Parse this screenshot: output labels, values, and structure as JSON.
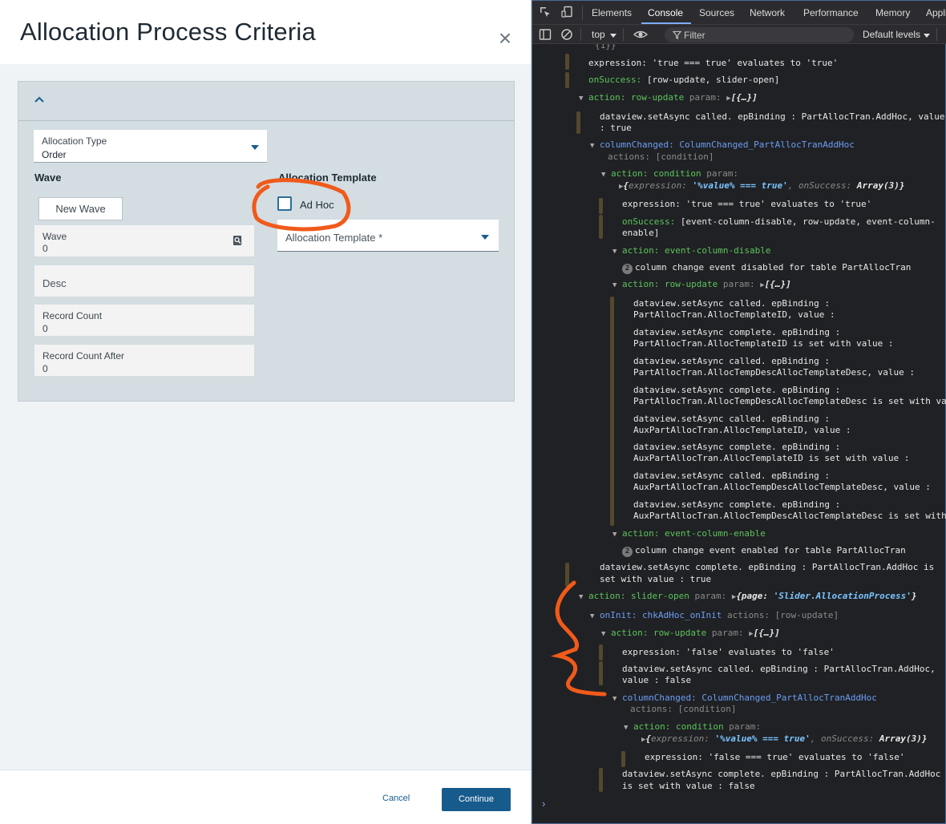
{
  "dialog": {
    "title": "Allocation Process Criteria",
    "close_icon": "×",
    "allocation_type": {
      "label": "Allocation Type",
      "value": "Order"
    },
    "wave_section": "Wave",
    "new_wave_button": "New Wave",
    "wave_field": {
      "label": "Wave",
      "value": "0"
    },
    "desc_field": {
      "placeholder": "Desc"
    },
    "record_count": {
      "label": "Record Count",
      "value": "0"
    },
    "record_count_after": {
      "label": "Record Count After",
      "value": "0"
    },
    "template_section": "Allocation Template",
    "adhoc_label": "Ad Hoc",
    "adhoc_checked": false,
    "template_field": {
      "placeholder": "Allocation Template *"
    },
    "cancel": "Cancel",
    "continue": "Continue"
  },
  "devtools": {
    "tabs": [
      "Elements",
      "Console",
      "Sources",
      "Network",
      "Performance",
      "Memory",
      "Application"
    ],
    "active_tab": "Console",
    "context": "top",
    "filter_placeholder": "Filter",
    "levels": "Default levels",
    "console": {
      "l0": "{1}}",
      "l1": "expression: 'true === true' evaluates to 'true'",
      "l2a": "onSuccess:",
      "l2b": "[row-update, slider-open]",
      "l3a": "action: row-update",
      "l3b": "param:",
      "l3c": "[{…}]",
      "l4a": "dataview.setAsync called. epBinding : PartAllocTran.AddHoc, value",
      "l4b": ": true",
      "l5a": "columnChanged: ColumnChanged_PartAllocTranAddHoc",
      "l5b": "actions: [condition]",
      "l6a": "action: condition",
      "l6b": "param:",
      "l7a": "expression:",
      "l7b": "'%value% === true'",
      "l7c": ", onSuccess:",
      "l7d": "Array(3)}",
      "l8": "expression: 'true === true' evaluates to 'true'",
      "l9a": "onSuccess:",
      "l9b": "[event-column-disable, row-update, event-column-",
      "l9c": "enable]",
      "l10": "action: event-column-disable",
      "l11n": "2",
      "l11": "column change event disabled for table PartAllocTran",
      "l12a": "action: row-update",
      "l12b": "param:",
      "l12c": "[{…}]",
      "l13a": "dataview.setAsync called. epBinding :",
      "l13b": "PartAllocTran.AllocTemplateID, value :",
      "l14a": "dataview.setAsync complete. epBinding :",
      "l14b": "PartAllocTran.AllocTemplateID is set with value :",
      "l15a": "dataview.setAsync called. epBinding :",
      "l15b": "PartAllocTran.AllocTempDescAllocTemplateDesc, value :",
      "l16a": "dataview.setAsync complete. epBinding :",
      "l16b": "PartAllocTran.AllocTempDescAllocTemplateDesc is set with value :",
      "l17a": "dataview.setAsync called. epBinding :",
      "l17b": "AuxPartAllocTran.AllocTemplateID, value :",
      "l18a": "dataview.setAsync complete. epBinding :",
      "l18b": "AuxPartAllocTran.AllocTemplateID is set with value :",
      "l19a": "dataview.setAsync called. epBinding :",
      "l19b": "AuxPartAllocTran.AllocTempDescAllocTemplateDesc, value :",
      "l20a": "dataview.setAsync complete. epBinding :",
      "l20b": "AuxPartAllocTran.AllocTempDescAllocTemplateDesc is set with value :",
      "l21": "action: event-column-enable",
      "l22n": "2",
      "l22": "column change event enabled for table PartAllocTran",
      "l23a": "dataview.setAsync complete. epBinding : PartAllocTran.AddHoc is",
      "l23b": "set with value : true",
      "l24a": "action: slider-open",
      "l24b": "param:",
      "l24c": "{page:",
      "l24d": "'Slider.AllocationProcess'",
      "l24e": "}",
      "l25a": "onInit: chkAdHoc_onInit",
      "l25b": "actions: [row-update]",
      "l26a": "action: row-update",
      "l26b": "param:",
      "l26c": "[{…}]",
      "l27": "expression: 'false' evaluates to 'false'",
      "l28a": "dataview.setAsync called. epBinding : PartAllocTran.AddHoc,",
      "l28b": "value : false",
      "l29a": "columnChanged: ColumnChanged_PartAllocTranAddHoc",
      "l29b": "actions: [condition]",
      "l30a": "action: condition",
      "l30b": "param:",
      "l31a": "expression:",
      "l31b": "'%value% === true'",
      "l31c": ", onSuccess:",
      "l31d": "Array(3)}",
      "l32": "expression: 'false === true' evaluates to 'false'",
      "l33a": "dataview.setAsync complete. epBinding : PartAllocTran.AddHoc",
      "l33b": "is set with value : false"
    }
  },
  "colors": {
    "accent": "#175b8c",
    "annotation": "#f05a1a",
    "devtools_bg": "#202124"
  }
}
